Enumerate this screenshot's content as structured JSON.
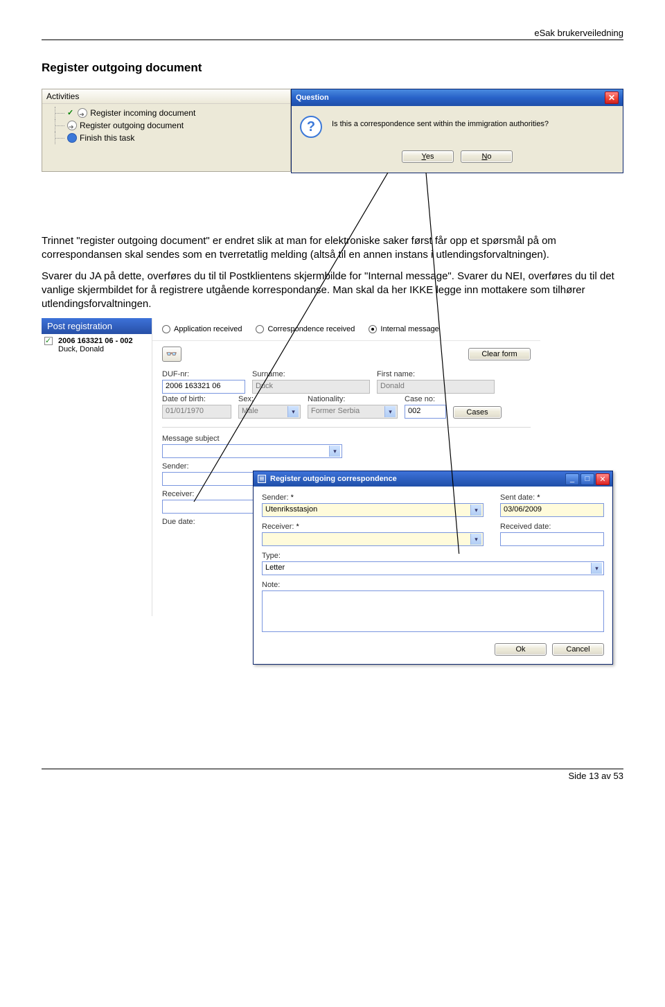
{
  "header": {
    "right": "eSak brukerveiledning"
  },
  "section_title": "Register outgoing document",
  "activities": {
    "title": "Activities",
    "items": [
      {
        "text": "Register incoming document",
        "done": true
      },
      {
        "text": "Register outgoing document",
        "done": false
      },
      {
        "text": "Finish this task",
        "blue": true
      }
    ]
  },
  "question": {
    "title": "Question",
    "message": "Is this a correspondence sent within the immigration authorities?",
    "yes": "Yes",
    "no": "No"
  },
  "para1": "Trinnet \"register outgoing document\" er endret slik at man for elektroniske saker først får opp et spørsmål på om correspondansen skal sendes som en tverretatlig melding (altså til en annen instans i utlendingsforvaltningen).",
  "para2": "Svarer du JA på dette, overføres du til til Postklientens skjermbilde for \"Internal message\". Svarer du NEI, overføres du til det vanlige skjermbildet for å registrere utgående korrespondanse. Man skal da her IKKE legge inn mottakere som tilhører utlendingsforvaltningen.",
  "post": {
    "tab": "Post registration",
    "ref": "2006 163321 06 - 002",
    "name": "Duck, Donald"
  },
  "form": {
    "radios": {
      "application_received": "Application received",
      "correspondence_received": "Correspondence received",
      "internal_message": "Internal message"
    },
    "clear_form": "Clear form",
    "labels": {
      "duf": "DUF-nr:",
      "surname": "Surname:",
      "firstname": "First name:",
      "dob": "Date of birth:",
      "sex": "Sex:",
      "nationality": "Nationality:",
      "caseno": "Case no:",
      "message_subject": "Message subject",
      "sender": "Sender:",
      "receiver": "Receiver:",
      "duedate": "Due date:"
    },
    "values": {
      "duf": "2006 163321 06",
      "surname": "Duck",
      "firstname": "Donald",
      "dob": "01/01/1970",
      "sex": "Male",
      "nationality": "Former Serbia",
      "caseno": "002",
      "cases_btn": "Cases"
    }
  },
  "corr": {
    "title": "Register outgoing correspondence",
    "labels": {
      "sender": "Sender:",
      "sent_date": "Sent date:",
      "receiver": "Receiver:",
      "received_date": "Received date:",
      "type": "Type:",
      "note": "Note:"
    },
    "values": {
      "sender": "Utenriksstasjon",
      "sent_date": "03/06/2009",
      "receiver": "",
      "received_date": "",
      "type": "Letter"
    },
    "ok": "Ok",
    "cancel": "Cancel"
  },
  "footer": "Side 13 av 53"
}
